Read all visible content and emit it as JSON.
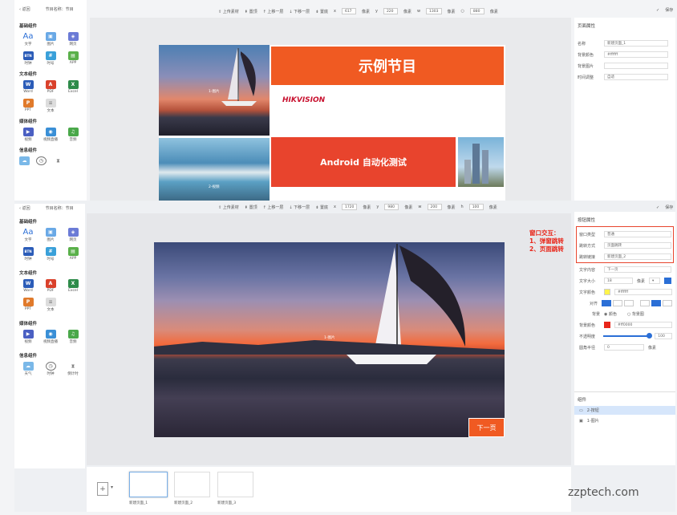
{
  "top": {
    "back": "返回",
    "program_name": "节目名称：节目",
    "toolbar": [
      "上传素材",
      "置顶",
      "上移一层",
      "下移一层",
      "置底"
    ],
    "x_label": "x",
    "x_val": "617",
    "x_unit": "像素",
    "y_label": "y",
    "y_val": "220",
    "y_unit": "像素",
    "w_label": "w",
    "w_val": "1303",
    "w_unit": "像素",
    "h_val": "880",
    "h_unit": "像素",
    "save": "保存",
    "sections": [
      {
        "title": "基础组件",
        "items": [
          "文字",
          "图片",
          "网页",
          "时钟",
          "时号",
          "APP"
        ]
      },
      {
        "title": "文本组件",
        "items": [
          "Word",
          "PDF",
          "Excel",
          "PPT",
          "文本"
        ]
      },
      {
        "title": "媒体组件",
        "items": [
          "视频",
          "视频直播",
          "音频"
        ]
      },
      {
        "title": "信息组件",
        "items": []
      }
    ],
    "slide": {
      "title": "示例节目",
      "brand": "HIKVISION",
      "subtitle": "Android 自动化测试",
      "img1_label": "1-图片",
      "img2_label": "2-视频"
    },
    "right": {
      "title": "页面属性",
      "rows": [
        {
          "label": "名称",
          "value": "新建页面_1"
        },
        {
          "label": "背景颜色",
          "value": "#ffffff"
        },
        {
          "label": "背景图片",
          "value": ""
        },
        {
          "label": "时间调整",
          "value": "自适"
        }
      ]
    }
  },
  "bottom": {
    "back": "返回",
    "program_name": "节目名称：节目",
    "toolbar": [
      "上传素材",
      "置顶",
      "上移一层",
      "下移一层",
      "置底"
    ],
    "x_val": "1720",
    "y_val": "980",
    "w_val": "200",
    "h_val": "100",
    "unit": "像素",
    "save": "保存",
    "sections": [
      {
        "title": "基础组件",
        "items": [
          "文字",
          "图片",
          "网页",
          "时钟",
          "时号",
          "APP"
        ]
      },
      {
        "title": "文本组件",
        "items": [
          "Word",
          "PDF",
          "Excel",
          "PPT",
          "文本"
        ]
      },
      {
        "title": "媒体组件",
        "items": [
          "视频",
          "视频直播",
          "音频"
        ]
      },
      {
        "title": "信息组件",
        "items": [
          "天气",
          "时钟",
          "倒计时"
        ]
      }
    ],
    "canvas": {
      "img_label": "1-图片",
      "button_text": "下一页"
    },
    "annotation": [
      "窗口交互：",
      "1、弹窗跳转",
      "2、页面跳转"
    ],
    "right": {
      "title": "按钮属性",
      "rows": [
        {
          "label": "窗口类型",
          "value": "普通"
        },
        {
          "label": "跳转方式",
          "value": "页面跳转"
        },
        {
          "label": "跳转链接",
          "value": "新建页面_2"
        },
        {
          "label": "文字内容",
          "value": "下一页"
        },
        {
          "label": "文字大小",
          "value": "18",
          "unit": "像素"
        },
        {
          "label": "文字颜色",
          "value": "#ffffff"
        },
        {
          "label": "对齐",
          "value": ""
        },
        {
          "label": "背景",
          "value": "颜色",
          "alt": "背景图"
        },
        {
          "label": "背景颜色",
          "value": "#ff0000"
        },
        {
          "label": "不透明度",
          "value": "100"
        },
        {
          "label": "圆角半径",
          "value": "0",
          "unit": "像素"
        }
      ],
      "components_title": "组件",
      "components": [
        "2-按钮",
        "1-图片"
      ]
    },
    "pages": [
      "新建页面_1",
      "新建页面_2",
      "新建页面_3"
    ]
  },
  "watermark": "zzptech.com",
  "colors": {
    "orange": "#f05a22",
    "red_bar": "#e8442d",
    "accent": "#2b6fd6"
  }
}
